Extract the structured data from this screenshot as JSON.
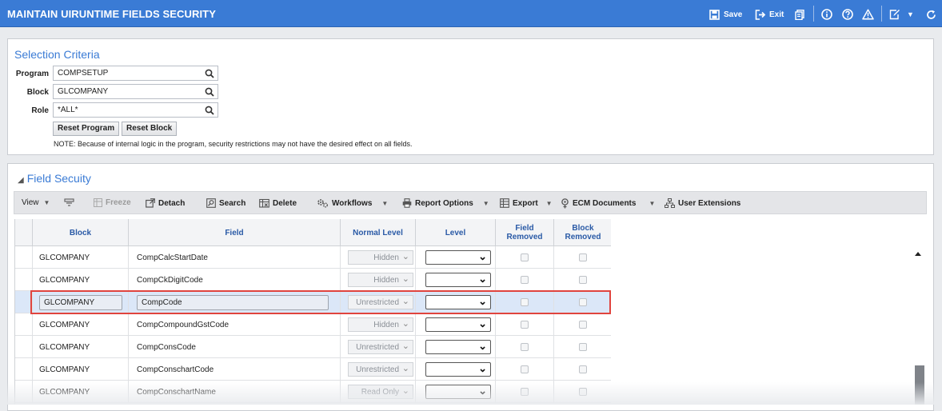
{
  "app": {
    "title": "MAINTAIN UIRUNTIME FIELDS SECURITY",
    "save_label": "Save",
    "exit_label": "Exit",
    "accent_color": "#3a7bd5"
  },
  "criteria": {
    "title": "Selection Criteria",
    "program_label": "Program",
    "program_value": "COMPSETUP",
    "block_label": "Block",
    "block_value": "GLCOMPANY",
    "role_label": "Role",
    "role_value": "*ALL*",
    "reset_program": "Reset Program",
    "reset_block": "Reset Block",
    "note": "NOTE: Because of internal logic in the program, security restrictions may not have the desired effect on all fields."
  },
  "security": {
    "title": "Field Secuity",
    "toolbar": {
      "view": "View",
      "freeze": "Freeze",
      "detach": "Detach",
      "search": "Search",
      "delete": "Delete",
      "workflows": "Workflows",
      "report_options": "Report Options",
      "export": "Export",
      "ecm_documents": "ECM Documents",
      "user_extensions": "User Extensions"
    },
    "columns": {
      "block": "Block",
      "field": "Field",
      "normal_level": "Normal Level",
      "level": "Level",
      "field_removed_1": "Field",
      "field_removed_2": "Removed",
      "block_removed_1": "Block",
      "block_removed_2": "Removed"
    },
    "rows": [
      {
        "block": "GLCOMPANY",
        "field": "CompCalcStartDate",
        "normal_level": "Hidden"
      },
      {
        "block": "GLCOMPANY",
        "field": "CompCkDigitCode",
        "normal_level": "Hidden"
      },
      {
        "block": "GLCOMPANY",
        "field": "CompCode",
        "normal_level": "Unrestricted"
      },
      {
        "block": "GLCOMPANY",
        "field": "CompCompoundGstCode",
        "normal_level": "Hidden"
      },
      {
        "block": "GLCOMPANY",
        "field": "CompConsCode",
        "normal_level": "Unrestricted"
      },
      {
        "block": "GLCOMPANY",
        "field": "CompConschartCode",
        "normal_level": "Unrestricted"
      },
      {
        "block": "GLCOMPANY",
        "field": "CompConschartName",
        "normal_level": "Read Only"
      }
    ]
  }
}
